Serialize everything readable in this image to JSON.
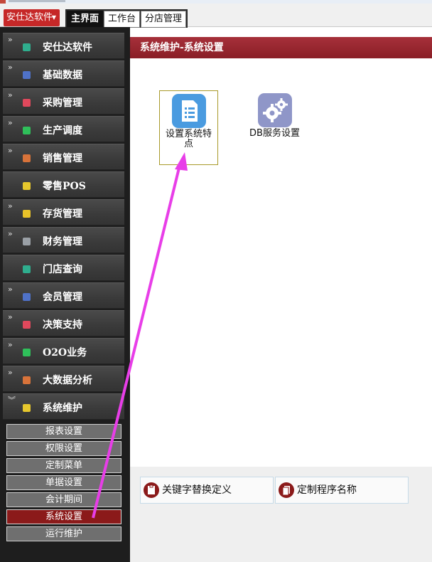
{
  "app_menu": {
    "label": "安仕达软件"
  },
  "tabs": [
    {
      "label": "主界面",
      "active": true
    },
    {
      "label": "工作台",
      "active": false
    },
    {
      "label": "分店管理",
      "active": false
    }
  ],
  "sidebar": {
    "items": [
      {
        "label": "安仕达软件",
        "icon": "teal-square-icon",
        "color": "#2fae8e"
      },
      {
        "label": "基础数据",
        "icon": "blue-square-icon",
        "color": "#4f72c8"
      },
      {
        "label": "采购管理",
        "icon": "red-square-icon",
        "color": "#e0485c"
      },
      {
        "label": "生产调度",
        "icon": "green-square-icon",
        "color": "#2fbf5a"
      },
      {
        "label": "销售管理",
        "icon": "orange-square-icon",
        "color": "#d8733a"
      },
      {
        "label": "零售POS",
        "icon": "yellow-square-icon",
        "color": "#e6c72d"
      },
      {
        "label": "存货管理",
        "icon": "yellow-square-icon",
        "color": "#e8c229"
      },
      {
        "label": "财务管理",
        "icon": "gray-square-icon",
        "color": "#9aa0a6"
      },
      {
        "label": "门店查询",
        "icon": "teal-square-icon",
        "color": "#2fae8e"
      },
      {
        "label": "会员管理",
        "icon": "blue-square-icon",
        "color": "#4f72c8"
      },
      {
        "label": "决策支持",
        "icon": "red-square-icon",
        "color": "#e0485c"
      },
      {
        "label": "O2O业务",
        "icon": "green-square-icon",
        "color": "#2fbf5a"
      },
      {
        "label": "大数据分析",
        "icon": "orange-square-icon",
        "color": "#d8733a"
      },
      {
        "label": "系统维护",
        "icon": "yellow-square-icon",
        "color": "#e6c72d",
        "expanded": true
      }
    ],
    "subitems": [
      {
        "label": "报表设置"
      },
      {
        "label": "权限设置"
      },
      {
        "label": "定制菜单"
      },
      {
        "label": "单据设置"
      },
      {
        "label": "会计期间"
      },
      {
        "label": "系统设置",
        "active": true
      },
      {
        "label": "运行维护"
      }
    ]
  },
  "content": {
    "header": "系统维护-系统设置",
    "tiles": [
      {
        "label": "设置系统特点",
        "icon": "document-list-icon",
        "color": "#4a9be0",
        "selected": true
      },
      {
        "label": "DB服务设置",
        "icon": "gears-icon",
        "color": "#8f96c8",
        "selected": false
      }
    ],
    "actions": [
      {
        "label": "关键字替换定义",
        "icon": "clipboard-icon"
      },
      {
        "label": "定制程序名称",
        "icon": "copy-document-icon"
      }
    ]
  },
  "annotation_color": "#e83ee8"
}
